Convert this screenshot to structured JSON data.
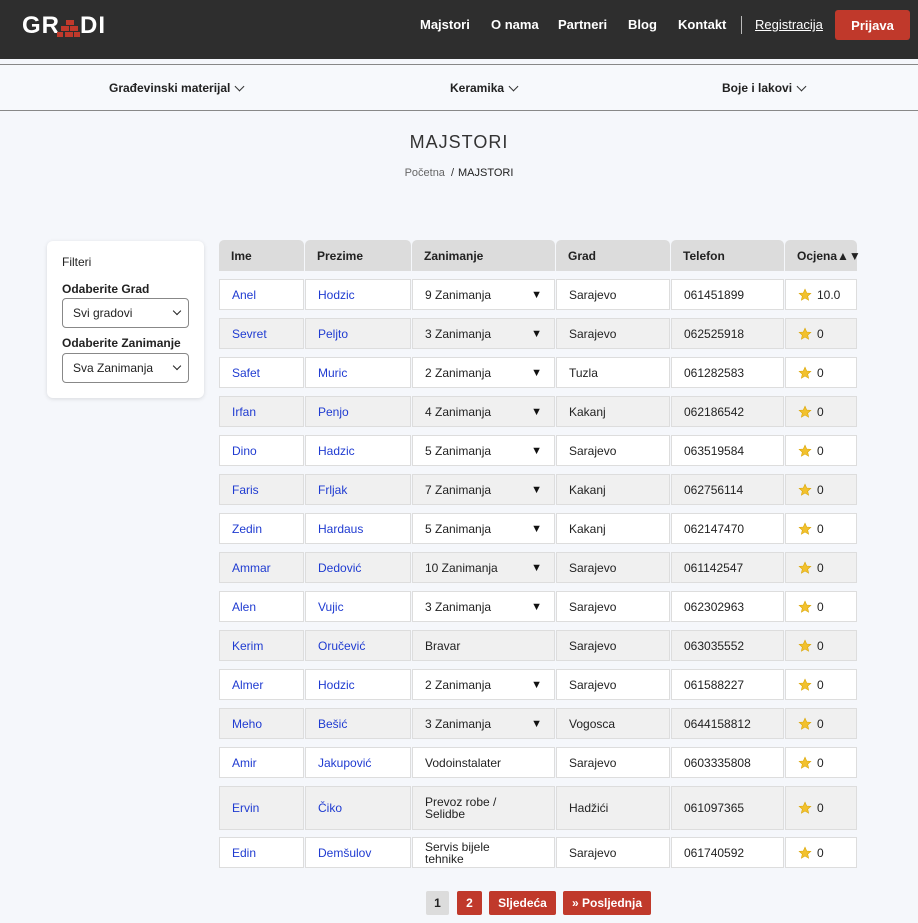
{
  "brand": {
    "logo_left": "GR",
    "logo_right": "DI"
  },
  "nav": {
    "items": [
      "Majstori",
      "O nama",
      "Partneri",
      "Blog",
      "Kontakt"
    ],
    "register": "Registracija",
    "login": "Prijava"
  },
  "categories": [
    "Građevinski materijal",
    "Keramika",
    "Boje i lakovi"
  ],
  "page": {
    "title": "MAJSTORI",
    "breadcrumb_home": "Početna",
    "breadcrumb_current": "MAJSTORI"
  },
  "filters": {
    "title": "Filteri",
    "city_label": "Odaberite Grad",
    "city_value": "Svi gradovi",
    "trade_label": "Odaberite Zanimanje",
    "trade_value": "Sva Zanimanja"
  },
  "table": {
    "headers": [
      "Ime",
      "Prezime",
      "Zanimanje",
      "Grad",
      "Telefon",
      "Ocjena▲▼"
    ],
    "rows": [
      {
        "ime": "Anel",
        "prezime": "Hodzic",
        "zanimanje": "9 Zanimanja",
        "dropdown": true,
        "grad": "Sarajevo",
        "telefon": "061451899",
        "ocjena": "10.0"
      },
      {
        "ime": "Sevret",
        "prezime": "Peljto",
        "zanimanje": "3 Zanimanja",
        "dropdown": true,
        "grad": "Sarajevo",
        "telefon": "062525918",
        "ocjena": "0"
      },
      {
        "ime": "Safet",
        "prezime": "Muric",
        "zanimanje": "2 Zanimanja",
        "dropdown": true,
        "grad": "Tuzla",
        "telefon": "061282583",
        "ocjena": "0"
      },
      {
        "ime": "Irfan",
        "prezime": "Penjo",
        "zanimanje": "4 Zanimanja",
        "dropdown": true,
        "grad": "Kakanj",
        "telefon": "062186542",
        "ocjena": "0"
      },
      {
        "ime": "Dino",
        "prezime": "Hadzic",
        "zanimanje": "5 Zanimanja",
        "dropdown": true,
        "grad": "Sarajevo",
        "telefon": "063519584",
        "ocjena": "0"
      },
      {
        "ime": "Faris",
        "prezime": "Frljak",
        "zanimanje": "7 Zanimanja",
        "dropdown": true,
        "grad": "Kakanj",
        "telefon": "062756114",
        "ocjena": "0"
      },
      {
        "ime": "Zedin",
        "prezime": "Hardaus",
        "zanimanje": "5 Zanimanja",
        "dropdown": true,
        "grad": "Kakanj",
        "telefon": "062147470",
        "ocjena": "0"
      },
      {
        "ime": "Ammar",
        "prezime": "Dedović",
        "zanimanje": "10 Zanimanja",
        "dropdown": true,
        "grad": "Sarajevo",
        "telefon": "061142547",
        "ocjena": "0"
      },
      {
        "ime": "Alen",
        "prezime": "Vujic",
        "zanimanje": "3 Zanimanja",
        "dropdown": true,
        "grad": "Sarajevo",
        "telefon": "062302963",
        "ocjena": "0"
      },
      {
        "ime": "Kerim",
        "prezime": "Oručević",
        "zanimanje": "Bravar",
        "dropdown": false,
        "grad": "Sarajevo",
        "telefon": "063035552",
        "ocjena": "0"
      },
      {
        "ime": "Almer",
        "prezime": "Hodzic",
        "zanimanje": "2 Zanimanja",
        "dropdown": true,
        "grad": "Sarajevo",
        "telefon": "061588227",
        "ocjena": "0"
      },
      {
        "ime": "Meho",
        "prezime": "Bešić",
        "zanimanje": "3 Zanimanja",
        "dropdown": true,
        "grad": "Vogosca",
        "telefon": "0644158812",
        "ocjena": "0"
      },
      {
        "ime": "Amir",
        "prezime": "Jakupović",
        "zanimanje": "Vodoinstalater",
        "dropdown": false,
        "grad": "Sarajevo",
        "telefon": "0603335808",
        "ocjena": "0"
      },
      {
        "ime": "Ervin",
        "prezime": "Čiko",
        "zanimanje": "Prevoz robe / Selidbe",
        "dropdown": false,
        "grad": "Hadžići",
        "telefon": "061097365",
        "ocjena": "0"
      },
      {
        "ime": "Edin",
        "prezime": "Demšulov",
        "zanimanje": "Servis bijele tehnike",
        "dropdown": false,
        "grad": "Sarajevo",
        "telefon": "061740592",
        "ocjena": "0"
      }
    ]
  },
  "pagination": {
    "pages": [
      "1",
      "2"
    ],
    "next": "Sljedeća",
    "last": "» Posljednja"
  },
  "colors": {
    "accent": "#c0392b",
    "topbar": "#2e2e2e",
    "link": "#1f3bd1",
    "star": "#f2c12e"
  }
}
